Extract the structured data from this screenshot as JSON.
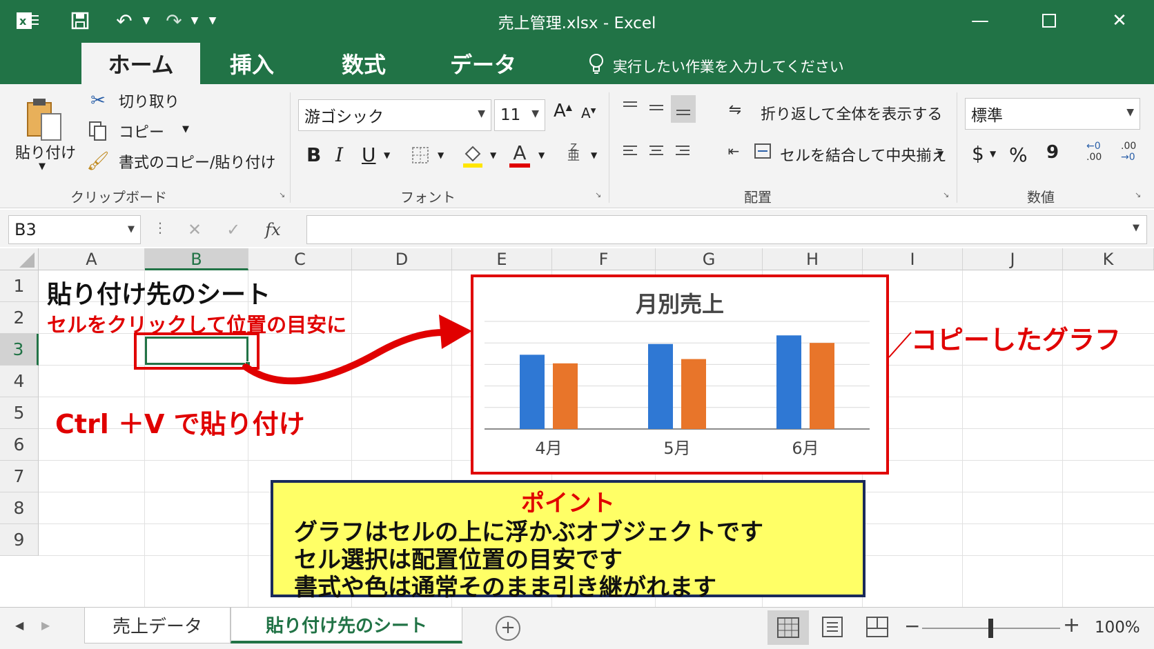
{
  "window": {
    "title": "売上管理.xlsx  -  Excel",
    "app_icon": "excel-logo-icon",
    "quick_access": [
      "save-icon",
      "undo-icon",
      "redo-icon",
      "customize-icon"
    ],
    "controls": [
      "minimize-icon",
      "maximize-icon",
      "close-icon"
    ]
  },
  "tabs": [
    {
      "label": "ホーム",
      "active": true
    },
    {
      "label": "挿入"
    },
    {
      "label": "数式"
    },
    {
      "label": "データ"
    }
  ],
  "tell_me": "実行したい作業を入力してください",
  "ribbon": {
    "clipboard": {
      "paste": "貼り付け",
      "cut": "切り取り",
      "copy": "コピー",
      "format_painter": "書式のコピー/貼り付け",
      "label": "クリップボード"
    },
    "font": {
      "name": "游ゴシック",
      "size": "11",
      "label": "フォント",
      "bold": "B",
      "italic": "I",
      "underline": "U",
      "grow": "A",
      "shrink": "A",
      "font_color": "A"
    },
    "alignment": {
      "wrap_text": "折り返して全体を表示する",
      "merge_center": "セルを結合して中央揃え",
      "label": "配置"
    },
    "number": {
      "format": "標準",
      "percent": "%",
      "comma": "9",
      "label": "数値",
      "inc_decimal": ".00",
      "dec_decimal": ".00"
    }
  },
  "formula_bar": {
    "name_box": "B3",
    "fx": "fx",
    "cancel": "✕",
    "enter": "✓",
    "value": ""
  },
  "grid": {
    "columns": [
      "A",
      "B",
      "C",
      "D",
      "E",
      "F",
      "G",
      "H",
      "I",
      "J",
      "K"
    ],
    "rows": [
      "1",
      "2",
      "3",
      "4",
      "5",
      "6",
      "7",
      "8",
      "9"
    ],
    "selected_cell": "B3",
    "title": "貼り付け先のシート",
    "note": "セルをクリックして位置の目安に",
    "instruction": "Ctrl ＋V で貼り付け",
    "copied_label": "コピーしたグラフ"
  },
  "chart_data": {
    "type": "bar",
    "title": "月別売上",
    "categories": [
      "4月",
      "5月",
      "6月"
    ],
    "series": [
      {
        "values": [
          69,
          79,
          87
        ],
        "color": "#2f78d4"
      },
      {
        "values": [
          61,
          65,
          80
        ],
        "color": "#e8752a"
      }
    ],
    "ylim": [
      0,
      100
    ],
    "grid": true,
    "legend": "none"
  },
  "point_box": {
    "heading": "ポイント",
    "lines": [
      "グラフはセルの上に浮かぶオブジェクトです",
      "セル選択は配置位置の目安です",
      "書式や色は通常そのまま引き継がれます"
    ]
  },
  "sheets": [
    {
      "name": "売上データ"
    },
    {
      "name": "貼り付け先のシート",
      "active": true
    }
  ],
  "status": {
    "zoom": "100%",
    "zoom_minus": "−",
    "zoom_plus": "+",
    "add_sheet": "+"
  },
  "colors": {
    "excel_green": "#217346",
    "accent_red": "#e00000",
    "note_yellow": "#ffff66"
  }
}
